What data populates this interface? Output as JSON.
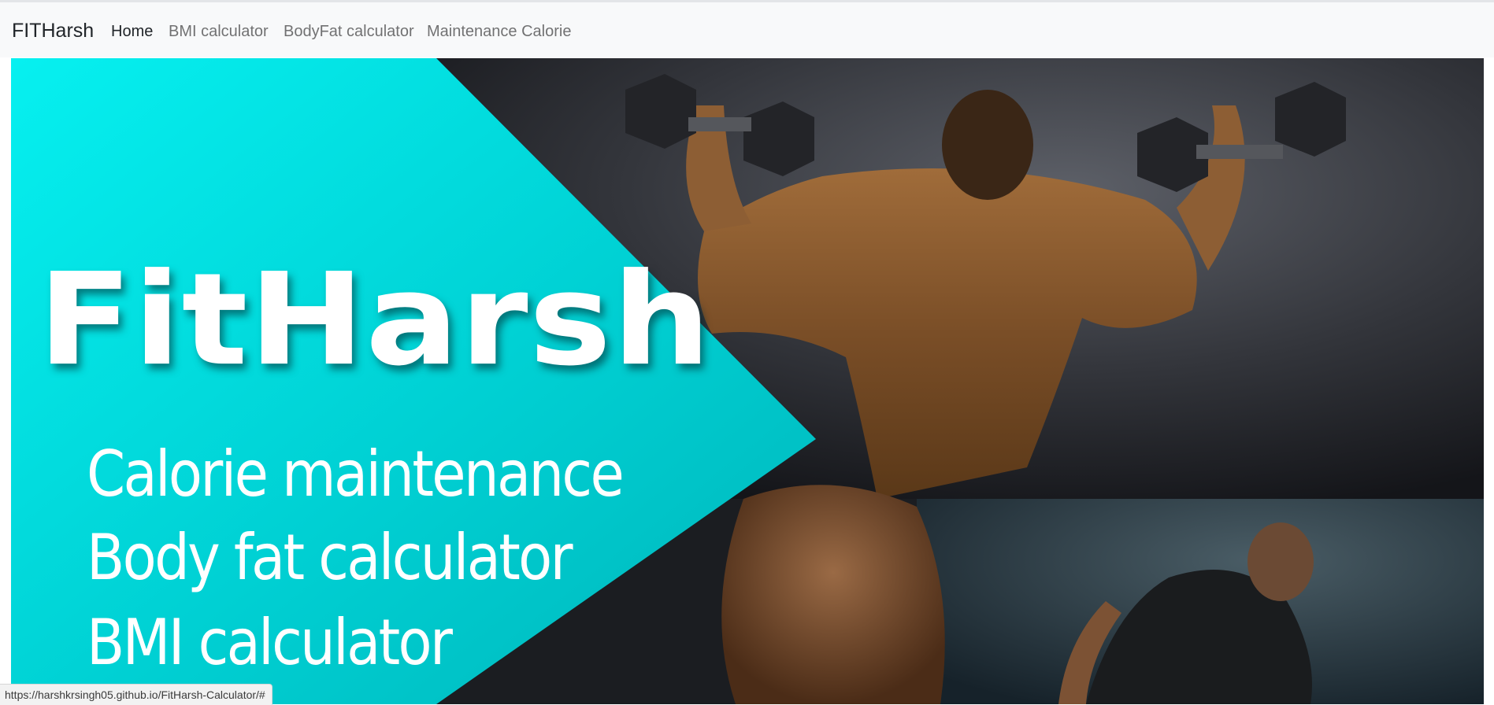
{
  "navbar": {
    "brand": "FITHarsh",
    "links": [
      {
        "label": "Home",
        "active": true
      },
      {
        "label": "BMI calculator",
        "active": false
      },
      {
        "label": "BodyFat calculator",
        "active": false
      },
      {
        "label": "Maintenance Calorie",
        "active": false
      }
    ]
  },
  "banner": {
    "logo_text": "FitHarsh",
    "features": [
      "Calorie maintenance",
      "Body fat calculator",
      "BMI calculator"
    ],
    "accent_color": "#00cdd2",
    "photo_left": "muscular-back-with-dumbbells-photo",
    "photo_right": "man-lifting-in-gym-photo"
  },
  "status_bar": {
    "url": "https://harshkrsingh05.github.io/FitHarsh-Calculator/#"
  }
}
